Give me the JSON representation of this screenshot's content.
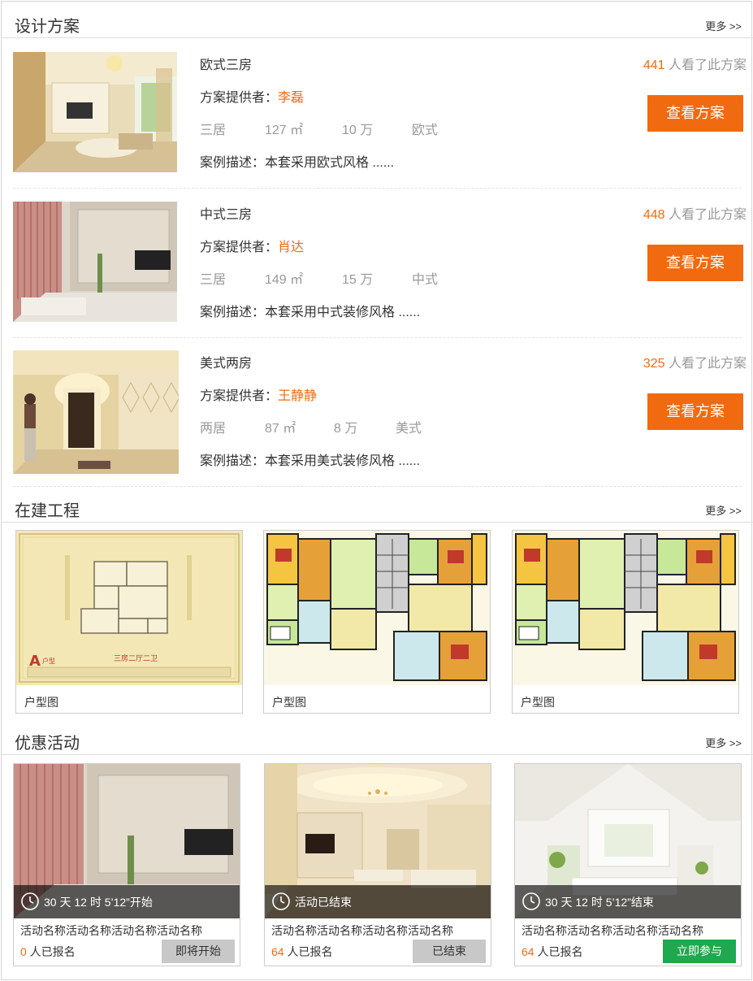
{
  "design": {
    "title": "设计方案",
    "more": "更多 >>",
    "items": [
      {
        "name": "欧式三房",
        "provider_label": "方案提供者：",
        "provider": "李磊",
        "rooms": "三居",
        "area": "127 ㎡",
        "price": "10 万",
        "style": "欧式",
        "desc": "案例描述：本套采用欧式风格 ......",
        "views": "441",
        "views_suffix": " 人看了此方案",
        "button": "查看方案"
      },
      {
        "name": "中式三房",
        "provider_label": "方案提供者：",
        "provider": "肖达",
        "rooms": "三居",
        "area": "149 ㎡",
        "price": "15 万",
        "style": "中式",
        "desc": "案例描述：本套采用中式装修风格 ......",
        "views": "448",
        "views_suffix": " 人看了此方案",
        "button": "查看方案"
      },
      {
        "name": "美式两房",
        "provider_label": "方案提供者：",
        "provider": "王静静",
        "rooms": "两居",
        "area": "87 ㎡",
        "price": "8 万",
        "style": "美式",
        "desc": "案例描述：本套采用美式装修风格 ......",
        "views": "325",
        "views_suffix": " 人看了此方案",
        "button": "查看方案"
      }
    ]
  },
  "construction": {
    "title": "在建工程",
    "more": "更多 >>",
    "items": [
      {
        "caption": "户型图",
        "plan_label": "A",
        "plan_sub": "户型",
        "plan_title": "三房二厅二卫"
      },
      {
        "caption": "户型图"
      },
      {
        "caption": "户型图"
      }
    ]
  },
  "promo": {
    "title": "优惠活动",
    "more": "更多 >>",
    "items": [
      {
        "time": "30 天 12 时 5’12”开始",
        "name": "活动名称活动名称活动名称活动名称",
        "count": "0",
        "count_suffix": " 人已报名",
        "button": "即将开始",
        "button_style": "gray"
      },
      {
        "time": "活动已结束",
        "name": "活动名称活动名称活动名称活动名称",
        "count": "64",
        "count_suffix": " 人已报名",
        "button": "已结束",
        "button_style": "gray"
      },
      {
        "time": "30 天 12 时 5’12”结束",
        "name": "活动名称活动名称活动名称活动名称",
        "count": "64",
        "count_suffix": " 人已报名",
        "button": "立即参与",
        "button_style": "green"
      }
    ]
  },
  "colors": {
    "accent": "#f26a10",
    "green": "#1fa84f",
    "gray_button": "#c8c8c8",
    "muted_text": "#999999"
  },
  "icons": {
    "clock": "clock-icon"
  }
}
